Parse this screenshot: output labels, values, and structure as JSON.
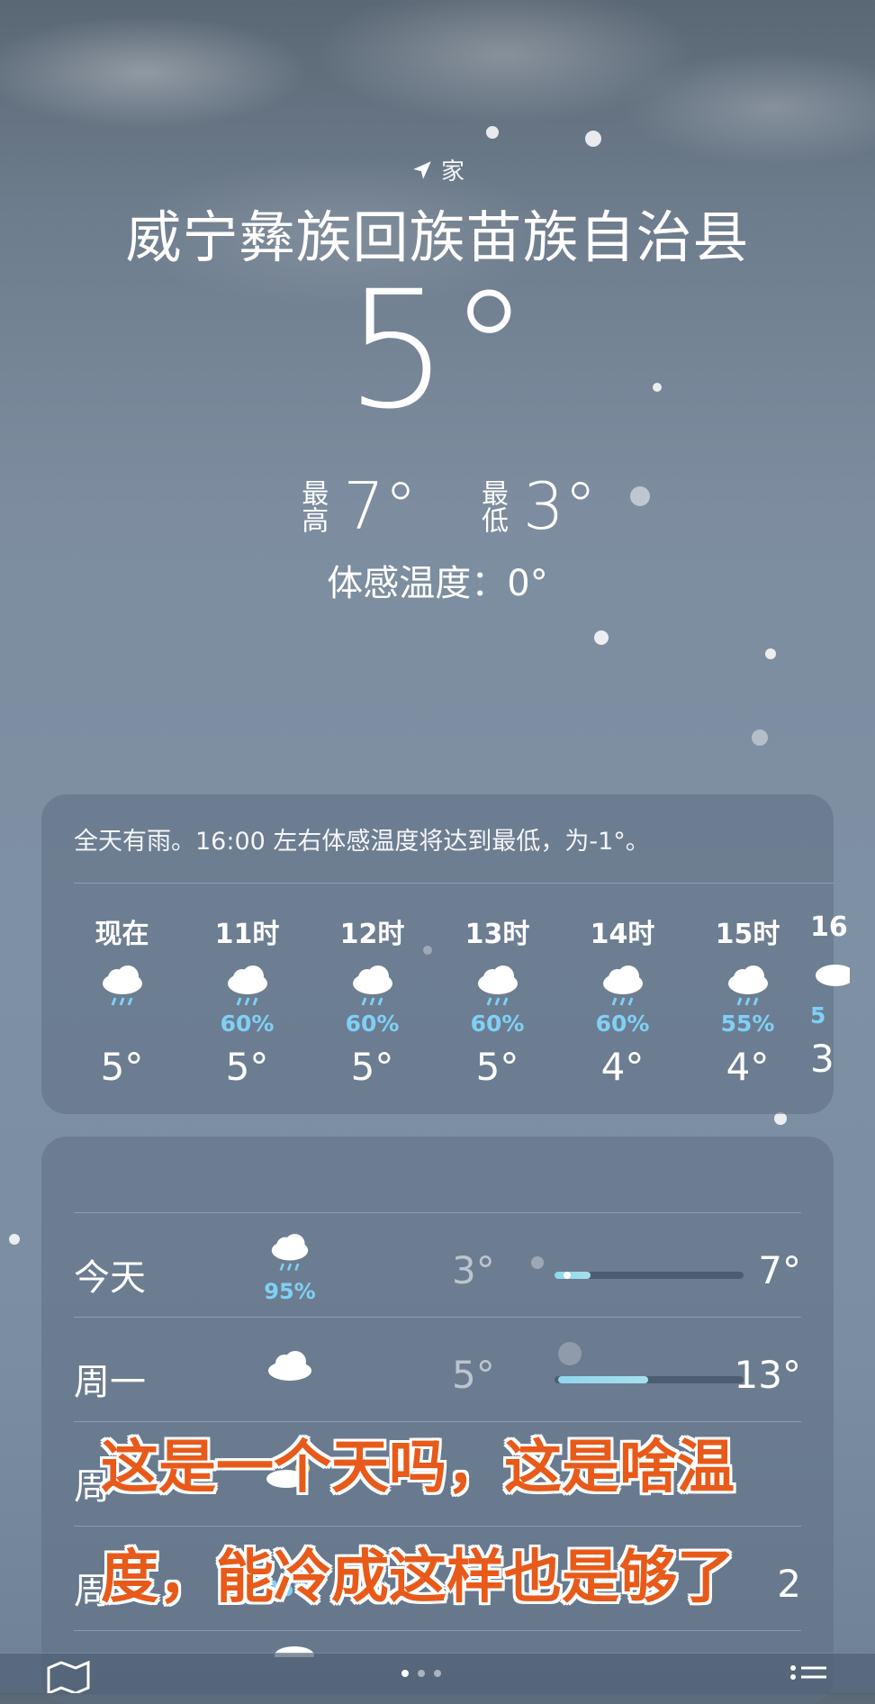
{
  "location": {
    "label": "家",
    "city": "威宁彝族回族苗族自治县"
  },
  "current": {
    "temperature": "5°",
    "high_label": "最高",
    "high": "7°",
    "low_label": "最低",
    "low": "3°",
    "feels_like": "体感温度：0°"
  },
  "hourly": {
    "summary": "全天有雨。16:00 左右体感温度将达到最低，为-1°。",
    "items": [
      {
        "label": "现在",
        "icon": "cloud-rain-icon",
        "precip": "",
        "temp": "5°"
      },
      {
        "label": "11时",
        "icon": "cloud-rain-icon",
        "precip": "60%",
        "temp": "5°"
      },
      {
        "label": "12时",
        "icon": "cloud-rain-icon",
        "precip": "60%",
        "temp": "5°"
      },
      {
        "label": "13时",
        "icon": "cloud-rain-icon",
        "precip": "60%",
        "temp": "5°"
      },
      {
        "label": "14时",
        "icon": "cloud-rain-icon",
        "precip": "60%",
        "temp": "4°"
      },
      {
        "label": "15时",
        "icon": "cloud-rain-icon",
        "precip": "55%",
        "temp": "4°"
      },
      {
        "label": "16",
        "icon": "cloud-rain-icon",
        "precip": "5",
        "temp": "3"
      }
    ]
  },
  "daily": [
    {
      "day": "今天",
      "icon": "cloud-rain-icon",
      "precip": "95%",
      "low": "3°",
      "high": "7°"
    },
    {
      "day": "周一",
      "icon": "cloud-icon",
      "precip": "",
      "low": "5°",
      "high": "13°"
    },
    {
      "day": "周",
      "icon": "cloud-sun-icon",
      "precip": "",
      "low": "",
      "high": ""
    },
    {
      "day": "周",
      "icon": "cloud-rain-icon",
      "precip": "35%",
      "low": "",
      "high": "2"
    }
  ],
  "caption": {
    "line1": "这是一个天吗，这是啥温",
    "line2": "度，能冷成这样也是够了"
  },
  "colors": {
    "precip": "#7fd0f5",
    "caption": "#e85a1a"
  }
}
